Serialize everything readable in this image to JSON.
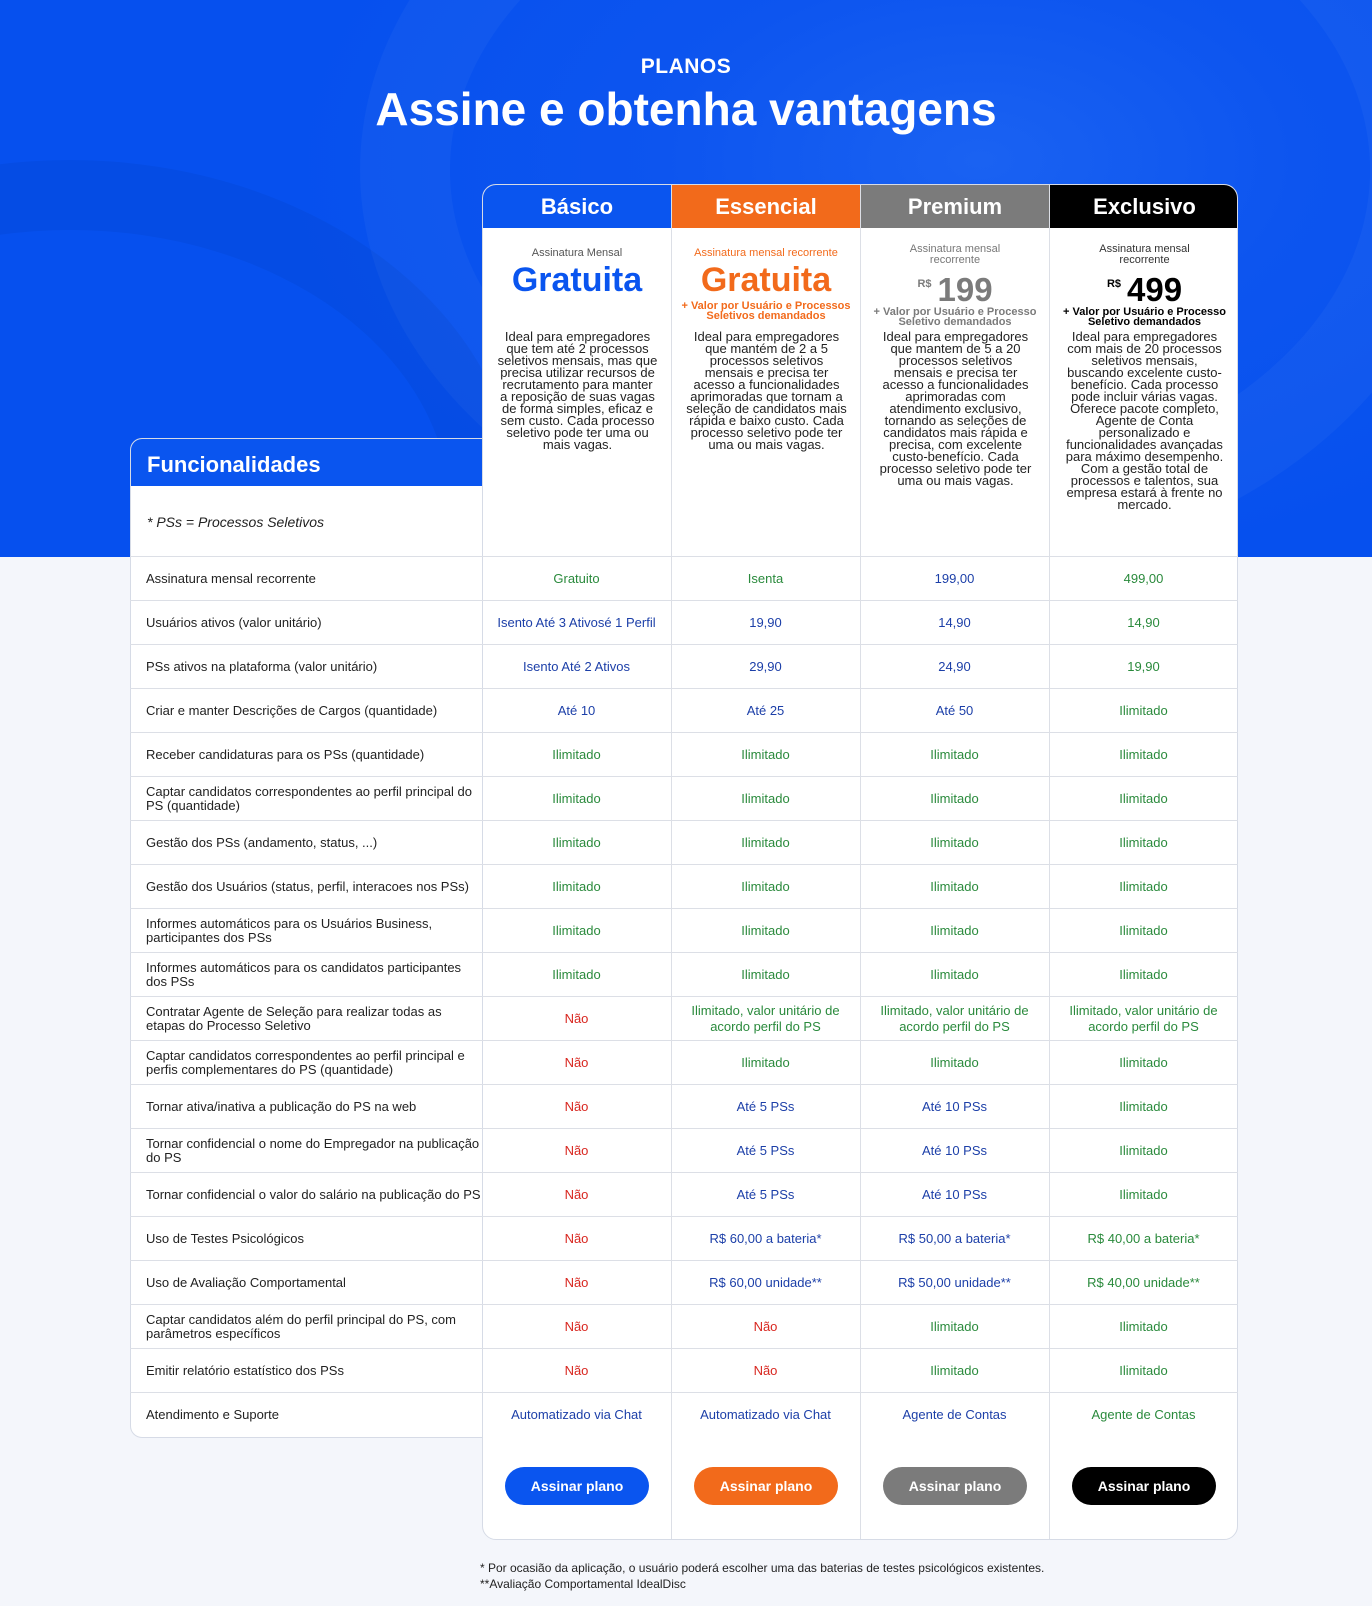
{
  "header": {
    "eyebrow": "PLANOS",
    "title": "Assine e obtenha vantagens"
  },
  "colors": {
    "basico": "#0a55ef",
    "essencial": "#f26a1b",
    "premium": "#7b7b7b",
    "exclusivo": "#000000",
    "green": "#2a8a3c",
    "blue": "#1c3fa8",
    "red": "#d8261f"
  },
  "plans": [
    {
      "name": "Básico",
      "sub": "Assinatura Mensal",
      "big": "Gratuita",
      "currency": "",
      "price": "",
      "note": "",
      "desc": "Ideal para empregadores que tem até 2 processos seletivos mensais, mas que precisa utilizar recursos de recrutamento para manter a reposição de suas vagas de forma simples, eficaz e sem custo. Cada processo seletivo pode ter uma ou mais vagas.",
      "button": "Assinar plano"
    },
    {
      "name": "Essencial",
      "sub": "Assinatura mensal recorrente",
      "big": "Gratuita",
      "currency": "",
      "price": "",
      "note": "+ Valor por Usuário e Processos Seletivos demandados",
      "desc": "Ideal para empregadores que mantém de 2 a 5 processos seletivos mensais e precisa ter acesso a funcionalidades aprimoradas que tornam a seleção de candidatos mais rápida e baixo custo. Cada processo seletivo pode ter uma ou mais vagas.",
      "button": "Assinar plano"
    },
    {
      "name": "Premium",
      "sub": "Assinatura mensal recorrente",
      "big": "",
      "currency": "R$",
      "price": "199",
      "note": "+ Valor por Usuário e Processo Seletivo demandados",
      "desc": "Ideal para empregadores que mantem de 5 a 20 processos seletivos mensais e precisa ter acesso a funcionalidades aprimoradas com atendimento exclusivo, tornando as seleções de candidatos mais rápida e precisa, com excelente custo-benefício. Cada processo seletivo pode ter uma ou mais vagas.",
      "button": "Assinar plano"
    },
    {
      "name": "Exclusivo",
      "sub": "Assinatura mensal recorrente",
      "big": "",
      "currency": "R$",
      "price": "499",
      "note": "+ Valor por Usuário e Processo Seletivo demandados",
      "desc": "Ideal para empregadores com mais de 20 processos seletivos mensais, buscando excelente custo-benefício. Cada processo pode incluir várias vagas. Oferece pacote completo, Agente de Conta personalizado e funcionalidades avançadas para máximo desempenho. Com a gestão total de processos e talentos, sua empresa estará à frente no mercado.",
      "button": "Assinar plano"
    }
  ],
  "features": {
    "title": "Funcionalidades",
    "note": "* PSs = Processos Seletivos",
    "rows": [
      {
        "label": "Assinatura mensal recorrente",
        "cells": [
          [
            "Gratuito",
            "g"
          ],
          [
            "Isenta",
            "g"
          ],
          [
            "199,00",
            "b"
          ],
          [
            "499,00",
            "g"
          ]
        ]
      },
      {
        "label": "Usuários ativos (valor unitário)",
        "cells": [
          [
            "Isento Até 3 Ativosé 1 Perfil",
            "b"
          ],
          [
            "19,90",
            "b"
          ],
          [
            "14,90",
            "b"
          ],
          [
            "14,90",
            "g"
          ]
        ]
      },
      {
        "label": "PSs ativos na plataforma (valor unitário)",
        "cells": [
          [
            "Isento Até 2 Ativos",
            "b"
          ],
          [
            "29,90",
            "b"
          ],
          [
            "24,90",
            "b"
          ],
          [
            "19,90",
            "g"
          ]
        ]
      },
      {
        "label": " Criar e manter Descrições de Cargos (quantidade)",
        "cells": [
          [
            "Até 10",
            "b"
          ],
          [
            "Até 25",
            "b"
          ],
          [
            "Até 50",
            "b"
          ],
          [
            "Ilimitado",
            "g"
          ]
        ]
      },
      {
        "label": " Receber candidaturas para os PSs (quantidade)",
        "cells": [
          [
            "Ilimitado",
            "g"
          ],
          [
            "Ilimitado",
            "g"
          ],
          [
            "Ilimitado",
            "g"
          ],
          [
            "Ilimitado",
            "g"
          ]
        ]
      },
      {
        "label": "Captar candidatos correspondentes ao perfil principal do PS (quantidade)",
        "cells": [
          [
            "Ilimitado",
            "g"
          ],
          [
            "Ilimitado",
            "g"
          ],
          [
            "Ilimitado",
            "g"
          ],
          [
            "Ilimitado",
            "g"
          ]
        ]
      },
      {
        "label": "Gestão dos PSs (andamento, status, ...)",
        "cells": [
          [
            "Ilimitado",
            "g"
          ],
          [
            "Ilimitado",
            "g"
          ],
          [
            "Ilimitado",
            "g"
          ],
          [
            "Ilimitado",
            "g"
          ]
        ]
      },
      {
        "label": "Gestão dos Usuários (status, perfil, interacoes nos PSs)",
        "cells": [
          [
            "Ilimitado",
            "g"
          ],
          [
            "Ilimitado",
            "g"
          ],
          [
            "Ilimitado",
            "g"
          ],
          [
            "Ilimitado",
            "g"
          ]
        ]
      },
      {
        "label": "Informes automáticos para os Usuários Business, participantes dos PSs",
        "cells": [
          [
            "Ilimitado",
            "g"
          ],
          [
            "Ilimitado",
            "g"
          ],
          [
            "Ilimitado",
            "g"
          ],
          [
            "Ilimitado",
            "g"
          ]
        ]
      },
      {
        "label": "Informes automáticos para os candidatos participantes dos PSs",
        "cells": [
          [
            "Ilimitado",
            "g"
          ],
          [
            "Ilimitado",
            "g"
          ],
          [
            "Ilimitado",
            "g"
          ],
          [
            "Ilimitado",
            "g"
          ]
        ]
      },
      {
        "label": "Contratar Agente de Seleção para realizar todas as etapas do Processo Seletivo",
        "cells": [
          [
            "Não",
            "r"
          ],
          [
            "Ilimitado, valor unitário de acordo perfil do PS",
            "g"
          ],
          [
            "Ilimitado, valor unitário de acordo perfil do PS",
            "g"
          ],
          [
            "Ilimitado, valor unitário de acordo perfil do PS",
            "g"
          ]
        ]
      },
      {
        "label": "Captar candidatos correspondentes ao perfil principal e perfis complementares do PS (quantidade)",
        "cells": [
          [
            "Não",
            "r"
          ],
          [
            "Ilimitado",
            "g"
          ],
          [
            "Ilimitado",
            "g"
          ],
          [
            "Ilimitado",
            "g"
          ]
        ]
      },
      {
        "label": "Tornar ativa/inativa a publicação do PS na web",
        "cells": [
          [
            "Não",
            "r"
          ],
          [
            "Até 5 PSs",
            "b"
          ],
          [
            "Até 10 PSs",
            "b"
          ],
          [
            "Ilimitado",
            "g"
          ]
        ]
      },
      {
        "label": "Tornar confidencial o nome do Empregador na publicação do PS",
        "cells": [
          [
            "Não",
            "r"
          ],
          [
            "Até 5 PSs",
            "b"
          ],
          [
            "Até 10 PSs",
            "b"
          ],
          [
            "Ilimitado",
            "g"
          ]
        ]
      },
      {
        "label": "Tornar confidencial o valor do salário na publicação do PS",
        "cells": [
          [
            "Não",
            "r"
          ],
          [
            "Até 5 PSs",
            "b"
          ],
          [
            "Até 10 PSs",
            "b"
          ],
          [
            "Ilimitado",
            "g"
          ]
        ]
      },
      {
        "label": "Uso de Testes Psicológicos",
        "cells": [
          [
            "Não",
            "r"
          ],
          [
            "R$ 60,00 a bateria*",
            "b"
          ],
          [
            "R$ 50,00 a bateria*",
            "b"
          ],
          [
            "R$ 40,00 a bateria*",
            "g"
          ]
        ]
      },
      {
        "label": "Uso de Avaliação Comportamental",
        "cells": [
          [
            "Não",
            "r"
          ],
          [
            "R$ 60,00 unidade**",
            "b"
          ],
          [
            "R$ 50,00 unidade**",
            "b"
          ],
          [
            "R$ 40,00 unidade**",
            "g"
          ]
        ]
      },
      {
        "label": "Captar candidatos além do perfil principal do PS, com parâmetros específicos",
        "cells": [
          [
            "Não",
            "r"
          ],
          [
            "Não",
            "r"
          ],
          [
            "Ilimitado",
            "g"
          ],
          [
            "Ilimitado",
            "g"
          ]
        ]
      },
      {
        "label": "Emitir relatório estatístico dos PSs",
        "cells": [
          [
            "Não",
            "r"
          ],
          [
            "Não",
            "r"
          ],
          [
            "Ilimitado",
            "g"
          ],
          [
            "Ilimitado",
            "g"
          ]
        ]
      },
      {
        "label": "Atendimento e Suporte",
        "cells": [
          [
            "Automatizado via Chat",
            "b"
          ],
          [
            "Automatizado via Chat",
            "b"
          ],
          [
            "Agente de Contas",
            "b"
          ],
          [
            "Agente de Contas",
            "g"
          ]
        ]
      }
    ]
  },
  "footnotes": [
    "* Por ocasião da aplicação, o usuário poderá escolher uma das baterias de testes psicológicos existentes.",
    "**Avaliação Comportamental IdealDisc"
  ]
}
